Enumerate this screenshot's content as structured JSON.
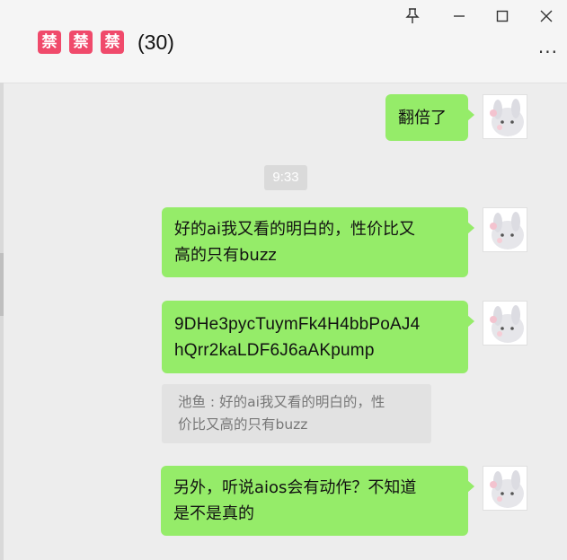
{
  "window_controls": {
    "pin_icon": "pin-icon",
    "minimize_icon": "minimize-icon",
    "maximize_icon": "maximize-icon",
    "close_icon": "close-icon"
  },
  "chat": {
    "title_tags": [
      "禁",
      "禁",
      "禁"
    ],
    "member_count": "(30)",
    "more_label": "···"
  },
  "messages": [
    {
      "lines": [
        "翻倍了"
      ]
    },
    {
      "lines": [
        "好的ai我又看的明白的，性价比又",
        "高的只有buzz"
      ]
    },
    {
      "lines": [
        "9DHe3pycTuymFk4H4bbPoAJ4",
        "hQrr2kaLDF6J6aAKpump"
      ]
    },
    {
      "lines": [
        "另外，听说aios会有动作？不知道",
        "是不是真的"
      ]
    }
  ],
  "timestamp": "9:33",
  "quote": {
    "lines": [
      "池鱼 : 好的ai我又看的明白的，性",
      "价比又高的只有buzz"
    ]
  },
  "colors": {
    "bubble": "#95ec69",
    "tag": "#f04a6b",
    "background": "#ededed"
  }
}
